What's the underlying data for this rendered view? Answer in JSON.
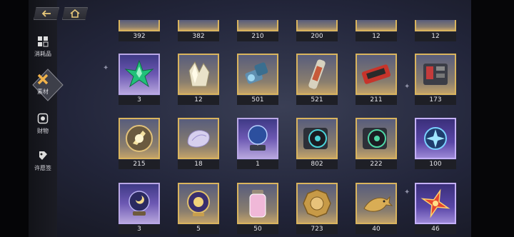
{
  "top": {
    "back_icon": "back-arrow-icon",
    "home_icon": "home-icon"
  },
  "sidebar": {
    "items": [
      {
        "label": "消耗品",
        "icon": "consumables-icon",
        "active": false
      },
      {
        "label": "素材",
        "icon": "materials-icon",
        "active": true
      },
      {
        "label": "财物",
        "icon": "valuables-icon",
        "active": false
      },
      {
        "label": "许愿签",
        "icon": "wish-tag-icon",
        "active": false
      }
    ]
  },
  "inventory": {
    "rows": [
      [
        {
          "count": "392",
          "icon": "item-partial-icon",
          "rarity": "gold"
        },
        {
          "count": "382",
          "icon": "item-partial-icon",
          "rarity": "gold"
        },
        {
          "count": "210",
          "icon": "item-partial-icon",
          "rarity": "gold"
        },
        {
          "count": "200",
          "icon": "item-partial-icon",
          "rarity": "gold"
        },
        {
          "count": "12",
          "icon": "item-partial-icon",
          "rarity": "gold"
        },
        {
          "count": "12",
          "icon": "item-partial-icon",
          "rarity": "gold"
        }
      ],
      [
        {
          "count": "3",
          "icon": "green-crystal-icon",
          "rarity": "purple"
        },
        {
          "count": "12",
          "icon": "white-crystal-icon",
          "rarity": "gold"
        },
        {
          "count": "501",
          "icon": "mechanical-part-icon",
          "rarity": "gold"
        },
        {
          "count": "521",
          "icon": "battery-tube-icon",
          "rarity": "gold"
        },
        {
          "count": "211",
          "icon": "red-cassette-icon",
          "rarity": "gold"
        },
        {
          "count": "173",
          "icon": "device-box-icon",
          "rarity": "gold"
        }
      ],
      [
        {
          "count": "215",
          "icon": "golden-orb-icon",
          "rarity": "gold"
        },
        {
          "count": "18",
          "icon": "shell-icon",
          "rarity": "gold"
        },
        {
          "count": "1",
          "icon": "globe-device-icon",
          "rarity": "purple"
        },
        {
          "count": "802",
          "icon": "chip-disc-icon",
          "rarity": "gold"
        },
        {
          "count": "222",
          "icon": "chip-disc-green-icon",
          "rarity": "gold"
        },
        {
          "count": "100",
          "icon": "star-gear-icon",
          "rarity": "violet"
        }
      ],
      [
        {
          "count": "3",
          "icon": "crystal-ball-icon",
          "rarity": "purple"
        },
        {
          "count": "5",
          "icon": "ornate-orb-icon",
          "rarity": "gold"
        },
        {
          "count": "50",
          "icon": "pink-jar-icon",
          "rarity": "gold"
        },
        {
          "count": "723",
          "icon": "gold-coin-icon",
          "rarity": "gold"
        },
        {
          "count": "40",
          "icon": "gold-fish-icon",
          "rarity": "gold"
        },
        {
          "count": "46",
          "icon": "red-star-icon",
          "rarity": "violet"
        }
      ]
    ]
  }
}
